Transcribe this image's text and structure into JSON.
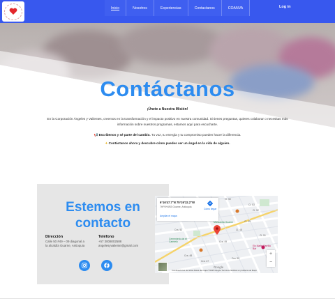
{
  "nav": {
    "items": [
      "Inicio",
      "Nosotros",
      "Experiencias",
      "Contactanos",
      "COANVA"
    ],
    "login": "Log in",
    "color": "#3858ee"
  },
  "hero": {
    "title": "Contáctanos",
    "subtitle": "¡Únete a Nuestra Misión!",
    "paragraph": "En la Corporación Ángeles y Valientes, creemos en la transformación y el impacto positivo en nuestra comunidad. Si tienes preguntas, quieres colaborar o necesitas más información sobre nuestros programas, estamos aquí para escucharte.",
    "line2_bold": "Escríbenos y sé parte del cambio.",
    "line2_rest": " Tu voz, tu energía y tu compromiso pueden hacer la diferencia.",
    "line3": "Contáctanos ahora y descubre cómo puedes ser un ángel en la vida de alguien.",
    "accent": "#2d8cf0"
  },
  "contact": {
    "title": "Estemos en contacto",
    "address_label": "Dirección",
    "address": "Calle 50 #49 – 09 diagonal a la alcaldía Guarne, Antioquia",
    "phone_label": "Teléfono",
    "phone": "+57 3008002588",
    "email": "angelesyvaliente@gmail.com",
    "social": [
      "instagram-icon",
      "facebook-icon"
    ]
  },
  "map": {
    "coords": "6°16'47.7\"N 75°26'32.2\"W",
    "address": "7HP8+W53 Guarne, Antioquia",
    "link": "Ampliar el mapa",
    "directions": "Cómo llegar",
    "labels": [
      "Cl. 50",
      "Cl. 52",
      "Cl. 48",
      "Cl. 49",
      "Cl. 51",
      "Cl. 53",
      "Cra. 52",
      "Cra. 49",
      "Cra. 47",
      "Cra. 48",
      "Cra. 50",
      "Manzanita Guarne",
      "Cementerio de el Carmelo",
      "Ely Marte Parrilla Bar",
      "Google"
    ],
    "footer": "Combinaciones de teclas   Datos del mapa ©2025 Google   Términos   Notificar un problema de Maps"
  }
}
